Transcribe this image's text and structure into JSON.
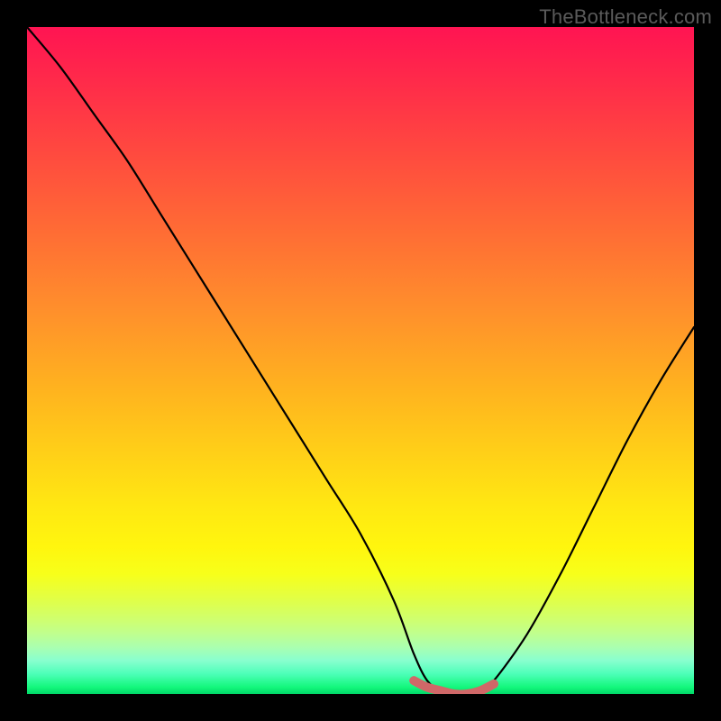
{
  "attribution": "TheBottleneck.com",
  "chart_data": {
    "type": "line",
    "title": "",
    "xlabel": "",
    "ylabel": "",
    "xlim": [
      0,
      100
    ],
    "ylim": [
      0,
      100
    ],
    "grid": false,
    "legend": false,
    "series": [
      {
        "name": "bottleneck-curve",
        "x": [
          0,
          5,
          10,
          15,
          20,
          25,
          30,
          35,
          40,
          45,
          50,
          55,
          58,
          60,
          62,
          64,
          66,
          68,
          70,
          75,
          80,
          85,
          90,
          95,
          100
        ],
        "values": [
          100,
          94,
          87,
          80,
          72,
          64,
          56,
          48,
          40,
          32,
          24,
          14,
          6,
          2,
          0.5,
          0,
          0,
          0.5,
          2,
          9,
          18,
          28,
          38,
          47,
          55
        ]
      },
      {
        "name": "optimal-range-marker",
        "x": [
          58,
          60,
          62,
          64,
          66,
          68,
          70
        ],
        "values": [
          2,
          1,
          0.5,
          0,
          0,
          0.5,
          1.5
        ]
      }
    ],
    "colors": {
      "curve": "#000000",
      "marker": "#d06868",
      "gradient_top": "#ff1452",
      "gradient_bottom": "#00d968"
    },
    "annotations": []
  }
}
